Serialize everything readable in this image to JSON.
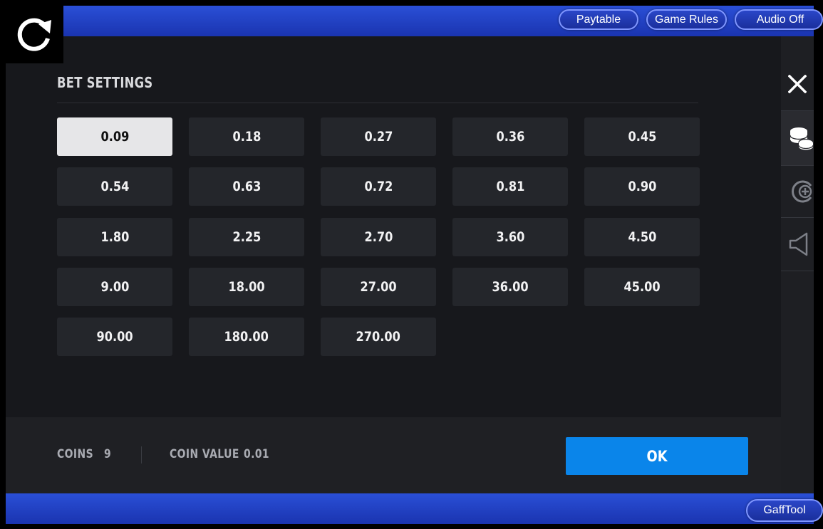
{
  "topbar": {
    "paytable_label": "Paytable",
    "rules_label": "Game Rules",
    "audio_label": "Audio Off"
  },
  "bet_settings": {
    "title": "BET SETTINGS",
    "selected": "0.09",
    "options": [
      "0.09",
      "0.18",
      "0.27",
      "0.36",
      "0.45",
      "0.54",
      "0.63",
      "0.72",
      "0.81",
      "0.90",
      "1.80",
      "2.25",
      "2.70",
      "3.60",
      "4.50",
      "9.00",
      "18.00",
      "27.00",
      "36.00",
      "45.00",
      "90.00",
      "180.00",
      "270.00"
    ]
  },
  "footer": {
    "coins_label": "COINS",
    "coins_value": "9",
    "coin_value_label": "COIN VALUE",
    "coin_value": "0.01",
    "ok_label": "OK"
  },
  "bottombar": {
    "gafftool_label": "GaffTool"
  },
  "sidebar": {
    "icons": [
      "close-icon",
      "coins-icon",
      "autoplay-icon",
      "speaker-icon"
    ]
  },
  "colors": {
    "bar_blue": "#1f3fc4",
    "ok_blue": "#0a85ea",
    "selected_bg": "#e6e6e8",
    "button_bg": "#24262b",
    "panel_bg": "#17181c"
  }
}
